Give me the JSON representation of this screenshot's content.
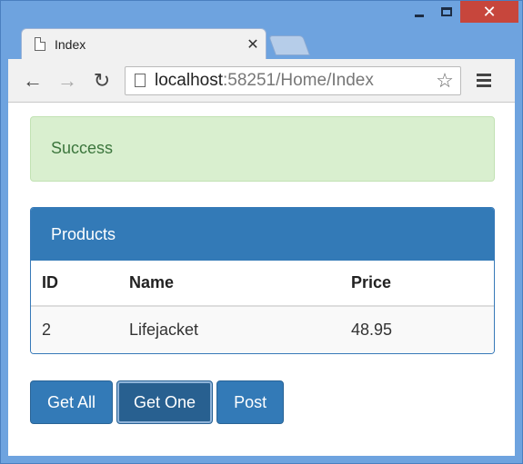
{
  "window": {
    "controls": {
      "minimize": "minimize-icon",
      "maximize": "maximize-icon",
      "close": "✕"
    }
  },
  "tab": {
    "title": "Index",
    "close_glyph": "✕"
  },
  "toolbar": {
    "back_glyph": "←",
    "forward_glyph": "→",
    "reload_glyph": "↻",
    "url_host": "localhost",
    "url_path": ":58251/Home/Index",
    "star_glyph": "☆"
  },
  "alert": {
    "text": "Success",
    "color": "#3c763d"
  },
  "panel": {
    "title": "Products",
    "columns": [
      "ID",
      "Name",
      "Price"
    ],
    "rows": [
      [
        "2",
        "Lifejacket",
        "48.95"
      ]
    ]
  },
  "buttons": {
    "get_all": "Get All",
    "get_one": "Get One",
    "post": "Post"
  },
  "colors": {
    "primary": "#337ab7",
    "alert_bg": "#d9efcf",
    "frame": "#6ea3df"
  }
}
